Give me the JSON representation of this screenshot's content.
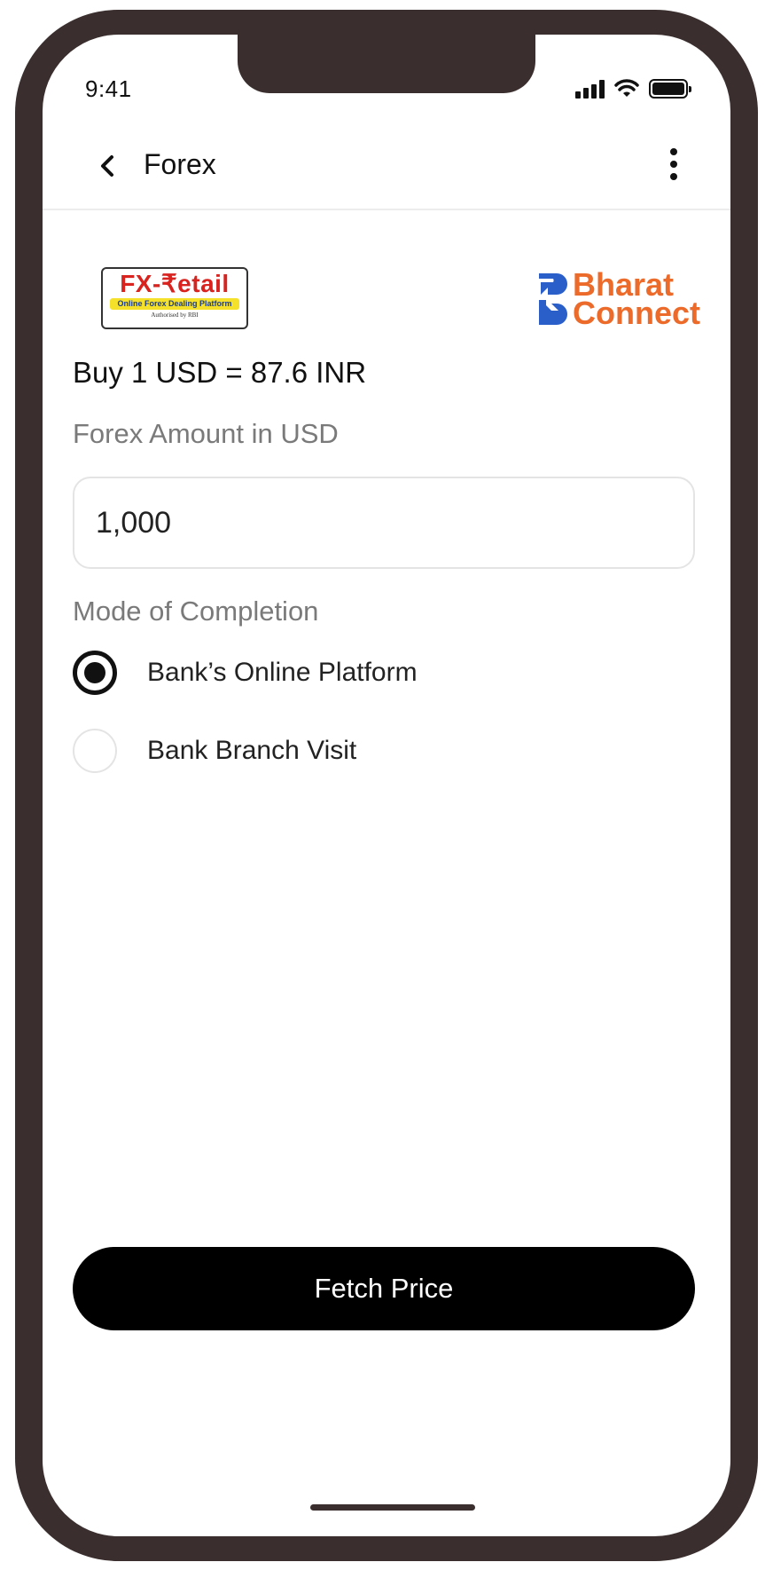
{
  "status_bar": {
    "time": "9:41"
  },
  "header": {
    "title": "Forex"
  },
  "logos": {
    "fx_retail": {
      "title": "FX-₹etail",
      "subtitle": "Online Forex Dealing Platform",
      "authorised": "Authorised by RBI"
    },
    "bharat_connect": {
      "line1": "Bharat",
      "line2": "Connect"
    }
  },
  "rate_text": "Buy 1 USD = 87.6 INR",
  "amount": {
    "label": "Forex Amount in USD",
    "value": "1,000"
  },
  "mode": {
    "label": "Mode of Completion",
    "options": [
      {
        "label": "Bank’s Online Platform",
        "selected": true
      },
      {
        "label": "Bank Branch Visit",
        "selected": false
      }
    ]
  },
  "fetch_button": {
    "label": "Fetch Price"
  },
  "colors": {
    "accent": "#000000",
    "frame": "#3a2e2e",
    "brand_orange": "#ec6a2a",
    "brand_blue": "#2a5ec9",
    "fx_red": "#d8231f"
  },
  "icons": {
    "back": "chevron-left-icon",
    "menu": "more-vertical-icon"
  }
}
